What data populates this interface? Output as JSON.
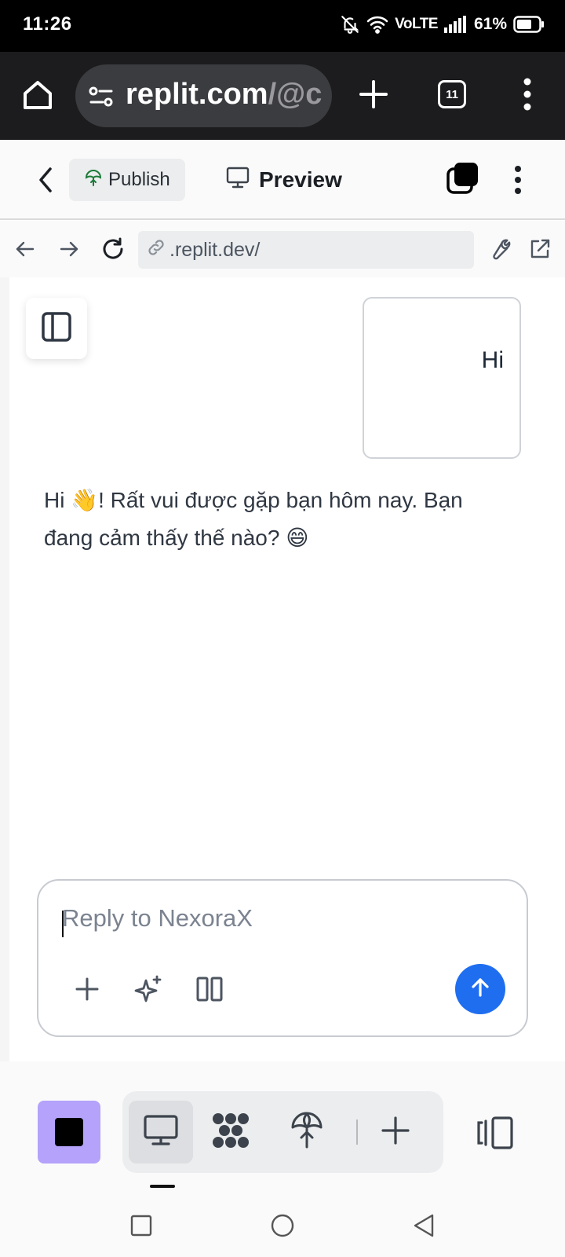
{
  "status_bar": {
    "time": "11:26",
    "network": "VoLTE",
    "battery": "61%"
  },
  "browser": {
    "url_main": "replit.com",
    "url_rest": "/@c",
    "tab_count": "11"
  },
  "replit_header": {
    "publish_label": "Publish",
    "preview_label": "Preview"
  },
  "preview_bar": {
    "url": ".replit.dev/"
  },
  "chat": {
    "user_message": "Hi",
    "ai_message": "Hi 👋! Rất vui được gặp bạn hôm nay. Bạn đang cảm thấy thế nào? 😄"
  },
  "composer": {
    "placeholder": "Reply to NexoraX"
  },
  "colors": {
    "send_button": "#1f6ef0",
    "stop_button": "#b4a2fb",
    "status_bar": "#000000",
    "browser_bar": "#1c1c1e"
  },
  "icons": {
    "status": [
      "bell-off-icon",
      "wifi-icon",
      "signal-icon",
      "battery-icon"
    ],
    "browser": [
      "home-icon",
      "site-settings-icon",
      "plus-icon",
      "tabs-icon",
      "more-vertical-icon"
    ],
    "header": [
      "back-icon",
      "publish-icon",
      "monitor-icon",
      "layers-icon",
      "more-vertical-icon"
    ],
    "preview_nav": [
      "arrow-left-icon",
      "arrow-right-icon",
      "refresh-icon",
      "link-icon",
      "wrench-icon",
      "external-link-icon"
    ],
    "composer": [
      "plus-icon",
      "sparkle-icon",
      "columns-icon",
      "arrow-up-icon"
    ],
    "toolbar": [
      "stop-icon",
      "monitor-icon",
      "workspace-icon",
      "deploy-icon",
      "plus-icon",
      "panel-icon"
    ],
    "android": [
      "recents-icon",
      "home-circle-icon",
      "back-triangle-icon"
    ]
  }
}
